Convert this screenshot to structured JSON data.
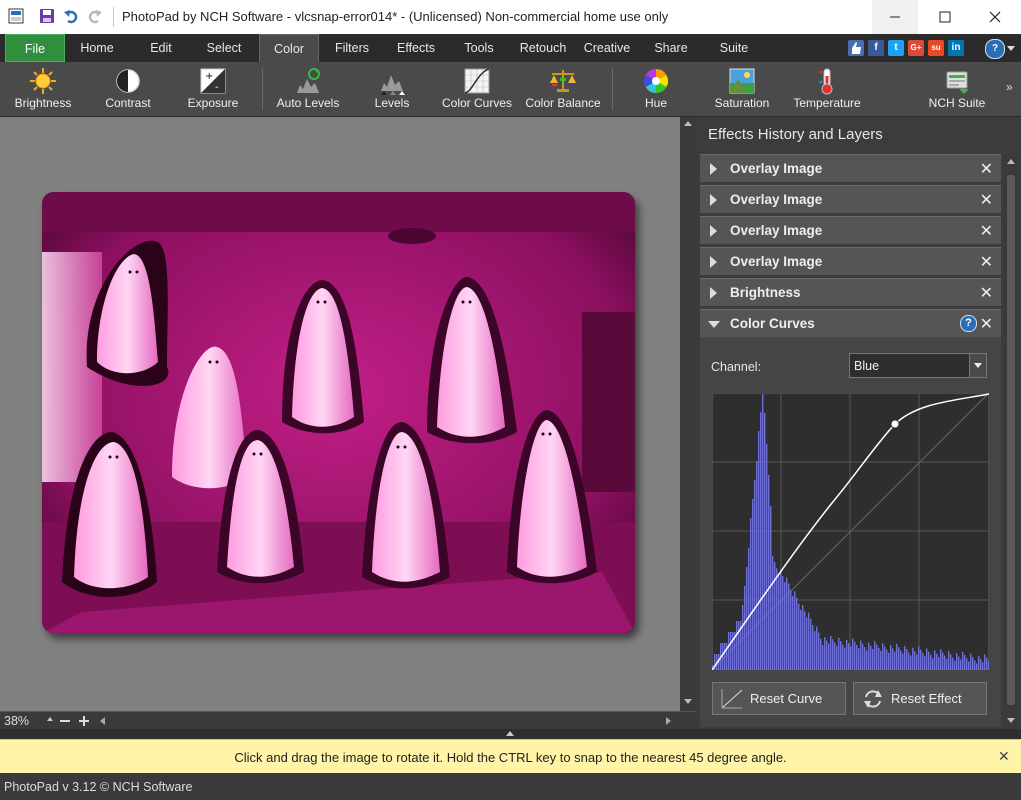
{
  "window": {
    "title": "PhotoPad by NCH Software - vlcsnap-error014* - (Unlicensed) Non-commercial home use only",
    "minimize_icon": "minimize-icon",
    "maximize_icon": "maximize-icon",
    "close_icon": "close-icon"
  },
  "quick_access": [
    "app-icon",
    "save-icon",
    "undo-icon",
    "redo-icon"
  ],
  "menu": {
    "items": [
      "File",
      "Home",
      "Edit",
      "Select",
      "Color",
      "Filters",
      "Effects",
      "Tools",
      "Retouch",
      "Creative",
      "Share",
      "Suite"
    ],
    "active": "Color",
    "social": [
      "like-icon",
      "facebook-icon",
      "twitter-icon",
      "google-plus-icon",
      "stumbleupon-icon",
      "linkedin-icon",
      "help-icon"
    ],
    "social_text": [
      "f",
      "t",
      "G+",
      "su",
      "in",
      "?"
    ]
  },
  "toolbar": {
    "tools": [
      "Brightness",
      "Contrast",
      "Exposure",
      "Auto Levels",
      "Levels",
      "Color Curves",
      "Color Balance",
      "Hue",
      "Saturation",
      "Temperature",
      "NCH Suite"
    ],
    "more": "»"
  },
  "canvas": {
    "zoom": "38%"
  },
  "panel": {
    "title": "Effects History and Layers",
    "layers": [
      "Overlay Image",
      "Overlay Image",
      "Overlay Image",
      "Overlay Image",
      "Brightness",
      "Color Curves"
    ],
    "expanded_layer": "Color Curves",
    "help_glyph": "?",
    "close_glyph": "✕",
    "channel_label": "Channel:",
    "channel_value": "Blue",
    "reset_curve": "Reset Curve",
    "reset_effect": "Reset Effect",
    "curve_color": "#ffffff",
    "histogram_color": "#6f6fd8"
  },
  "hint": {
    "text": "Click and drag the image to rotate it. Hold the CTRL key to snap to the nearest 45 degree angle.",
    "close_glyph": "✕"
  },
  "status": {
    "text": "PhotoPad v 3.12 © NCH Software"
  },
  "colors": {
    "file_tab": "#2f8f3f",
    "hint_bar": "#fff4a8",
    "photo_tint": "#a0186f"
  }
}
